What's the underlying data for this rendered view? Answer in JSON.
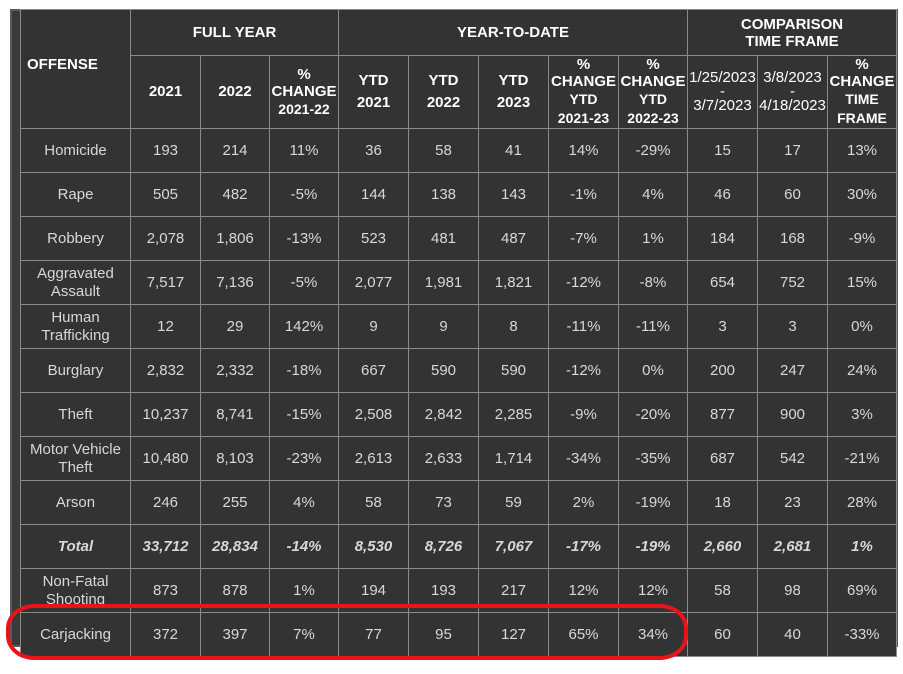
{
  "headers": {
    "offense": "OFFENSE",
    "full_year": "FULL YEAR",
    "ytd": "YEAR-TO-DATE",
    "comparison_line1": "COMPARISON",
    "comparison_line2": "TIME FRAME",
    "y2021": "2021",
    "y2022": "2022",
    "fy_change_small": "% CHANGE",
    "fy_change_years": "2021-22",
    "ytd_label": "YTD",
    "ytd_2021": "2021",
    "ytd_2022": "2022",
    "ytd_2023": "2023",
    "ytd_chg_small": "% CHANGE",
    "ytd_chg_label": "YTD",
    "ytd_chg_2123": "2021-23",
    "ytd_chg_2223": "2022-23",
    "cmp1_start": "1/25/2023",
    "cmp1_dash": "-",
    "cmp1_end": "3/7/2023",
    "cmp2_start": "3/8/2023",
    "cmp2_dash": "-",
    "cmp2_end": "4/18/2023",
    "cmp_chg_small": "% CHANGE",
    "cmp_chg_l1": "TIME",
    "cmp_chg_l2": "FRAME"
  },
  "rows": [
    {
      "offense": "Homicide",
      "fy2021": "193",
      "fy2022": "214",
      "fychg": "11%",
      "fychg_c": "red",
      "ytd2021": "36",
      "ytd2022": "58",
      "ytd2023": "41",
      "chg2123": "14%",
      "chg2123_c": "red",
      "chg2223": "-29%",
      "chg2223_c": "green",
      "tf1": "15",
      "tf2": "17",
      "tfchg": "13%",
      "tfchg_c": "red"
    },
    {
      "offense": "Rape",
      "fy2021": "505",
      "fy2022": "482",
      "fychg": "-5%",
      "fychg_c": "green",
      "ytd2021": "144",
      "ytd2022": "138",
      "ytd2023": "143",
      "chg2123": "-1%",
      "chg2123_c": "green",
      "chg2223": "4%",
      "chg2223_c": "red",
      "tf1": "46",
      "tf2": "60",
      "tfchg": "30%",
      "tfchg_c": "red"
    },
    {
      "offense": "Robbery",
      "fy2021": "2,078",
      "fy2022": "1,806",
      "fychg": "-13%",
      "fychg_c": "green",
      "ytd2021": "523",
      "ytd2022": "481",
      "ytd2023": "487",
      "chg2123": "-7%",
      "chg2123_c": "green",
      "chg2223": "1%",
      "chg2223_c": "red",
      "tf1": "184",
      "tf2": "168",
      "tfchg": "-9%",
      "tfchg_c": "green"
    },
    {
      "offense": "Aggravated Assault",
      "fy2021": "7,517",
      "fy2022": "7,136",
      "fychg": "-5%",
      "fychg_c": "green",
      "ytd2021": "2,077",
      "ytd2022": "1,981",
      "ytd2023": "1,821",
      "chg2123": "-12%",
      "chg2123_c": "green",
      "chg2223": "-8%",
      "chg2223_c": "green",
      "tf1": "654",
      "tf2": "752",
      "tfchg": "15%",
      "tfchg_c": "red"
    },
    {
      "offense": "Human Trafficking",
      "fy2021": "12",
      "fy2022": "29",
      "fychg": "142%",
      "fychg_c": "red",
      "ytd2021": "9",
      "ytd2022": "9",
      "ytd2023": "8",
      "chg2123": "-11%",
      "chg2123_c": "green",
      "chg2223": "-11%",
      "chg2223_c": "green",
      "tf1": "3",
      "tf2": "3",
      "tfchg": "0%",
      "tfchg_c": "green"
    },
    {
      "offense": "Burglary",
      "fy2021": "2,832",
      "fy2022": "2,332",
      "fychg": "-18%",
      "fychg_c": "green",
      "ytd2021": "667",
      "ytd2022": "590",
      "ytd2023": "590",
      "chg2123": "-12%",
      "chg2123_c": "green",
      "chg2223": "0%",
      "chg2223_c": "green",
      "tf1": "200",
      "tf2": "247",
      "tfchg": "24%",
      "tfchg_c": "red"
    },
    {
      "offense": "Theft",
      "fy2021": "10,237",
      "fy2022": "8,741",
      "fychg": "-15%",
      "fychg_c": "green",
      "ytd2021": "2,508",
      "ytd2022": "2,842",
      "ytd2023": "2,285",
      "chg2123": "-9%",
      "chg2123_c": "green",
      "chg2223": "-20%",
      "chg2223_c": "green",
      "tf1": "877",
      "tf2": "900",
      "tfchg": "3%",
      "tfchg_c": "red"
    },
    {
      "offense": "Motor Vehicle Theft",
      "fy2021": "10,480",
      "fy2022": "8,103",
      "fychg": "-23%",
      "fychg_c": "green",
      "ytd2021": "2,613",
      "ytd2022": "2,633",
      "ytd2023": "1,714",
      "chg2123": "-34%",
      "chg2123_c": "green",
      "chg2223": "-35%",
      "chg2223_c": "green",
      "tf1": "687",
      "tf2": "542",
      "tfchg": "-21%",
      "tfchg_c": "green"
    },
    {
      "offense": "Arson",
      "fy2021": "246",
      "fy2022": "255",
      "fychg": "4%",
      "fychg_c": "red",
      "ytd2021": "58",
      "ytd2022": "73",
      "ytd2023": "59",
      "chg2123": "2%",
      "chg2123_c": "red",
      "chg2223": "-19%",
      "chg2223_c": "green",
      "tf1": "18",
      "tf2": "23",
      "tfchg": "28%",
      "tfchg_c": "red"
    },
    {
      "offense": "Total",
      "fy2021": "33,712",
      "fy2022": "28,834",
      "fychg": "-14%",
      "fychg_c": "green",
      "ytd2021": "8,530",
      "ytd2022": "8,726",
      "ytd2023": "7,067",
      "chg2123": "-17%",
      "chg2123_c": "green",
      "chg2223": "-19%",
      "chg2223_c": "green",
      "tf1": "2,660",
      "tf2": "2,681",
      "tfchg": "1%",
      "tfchg_c": "green",
      "kind": "total"
    },
    {
      "offense": "Non-Fatal Shooting",
      "fy2021": "873",
      "fy2022": "878",
      "fychg": "1%",
      "fychg_c": "green",
      "ytd2021": "194",
      "ytd2022": "193",
      "ytd2023": "217",
      "chg2123": "12%",
      "chg2123_c": "red",
      "chg2223": "12%",
      "chg2223_c": "red",
      "tf1": "58",
      "tf2": "98",
      "tfchg": "69%",
      "tfchg_c": "red",
      "kind": "sep"
    },
    {
      "offense": "Carjacking",
      "fy2021": "372",
      "fy2022": "397",
      "fychg": "7%",
      "fychg_c": "red",
      "ytd2021": "77",
      "ytd2022": "95",
      "ytd2023": "127",
      "chg2123": "65%",
      "chg2123_c": "red",
      "chg2223": "34%",
      "chg2223_c": "red",
      "tf1": "60",
      "tf2": "40",
      "tfchg": "-33%",
      "tfchg_c": "green"
    }
  ],
  "colors": {
    "background": "#333333",
    "positive_change": "#d9302c",
    "negative_change": "#2fb82f",
    "annotation": "#e8141a"
  }
}
